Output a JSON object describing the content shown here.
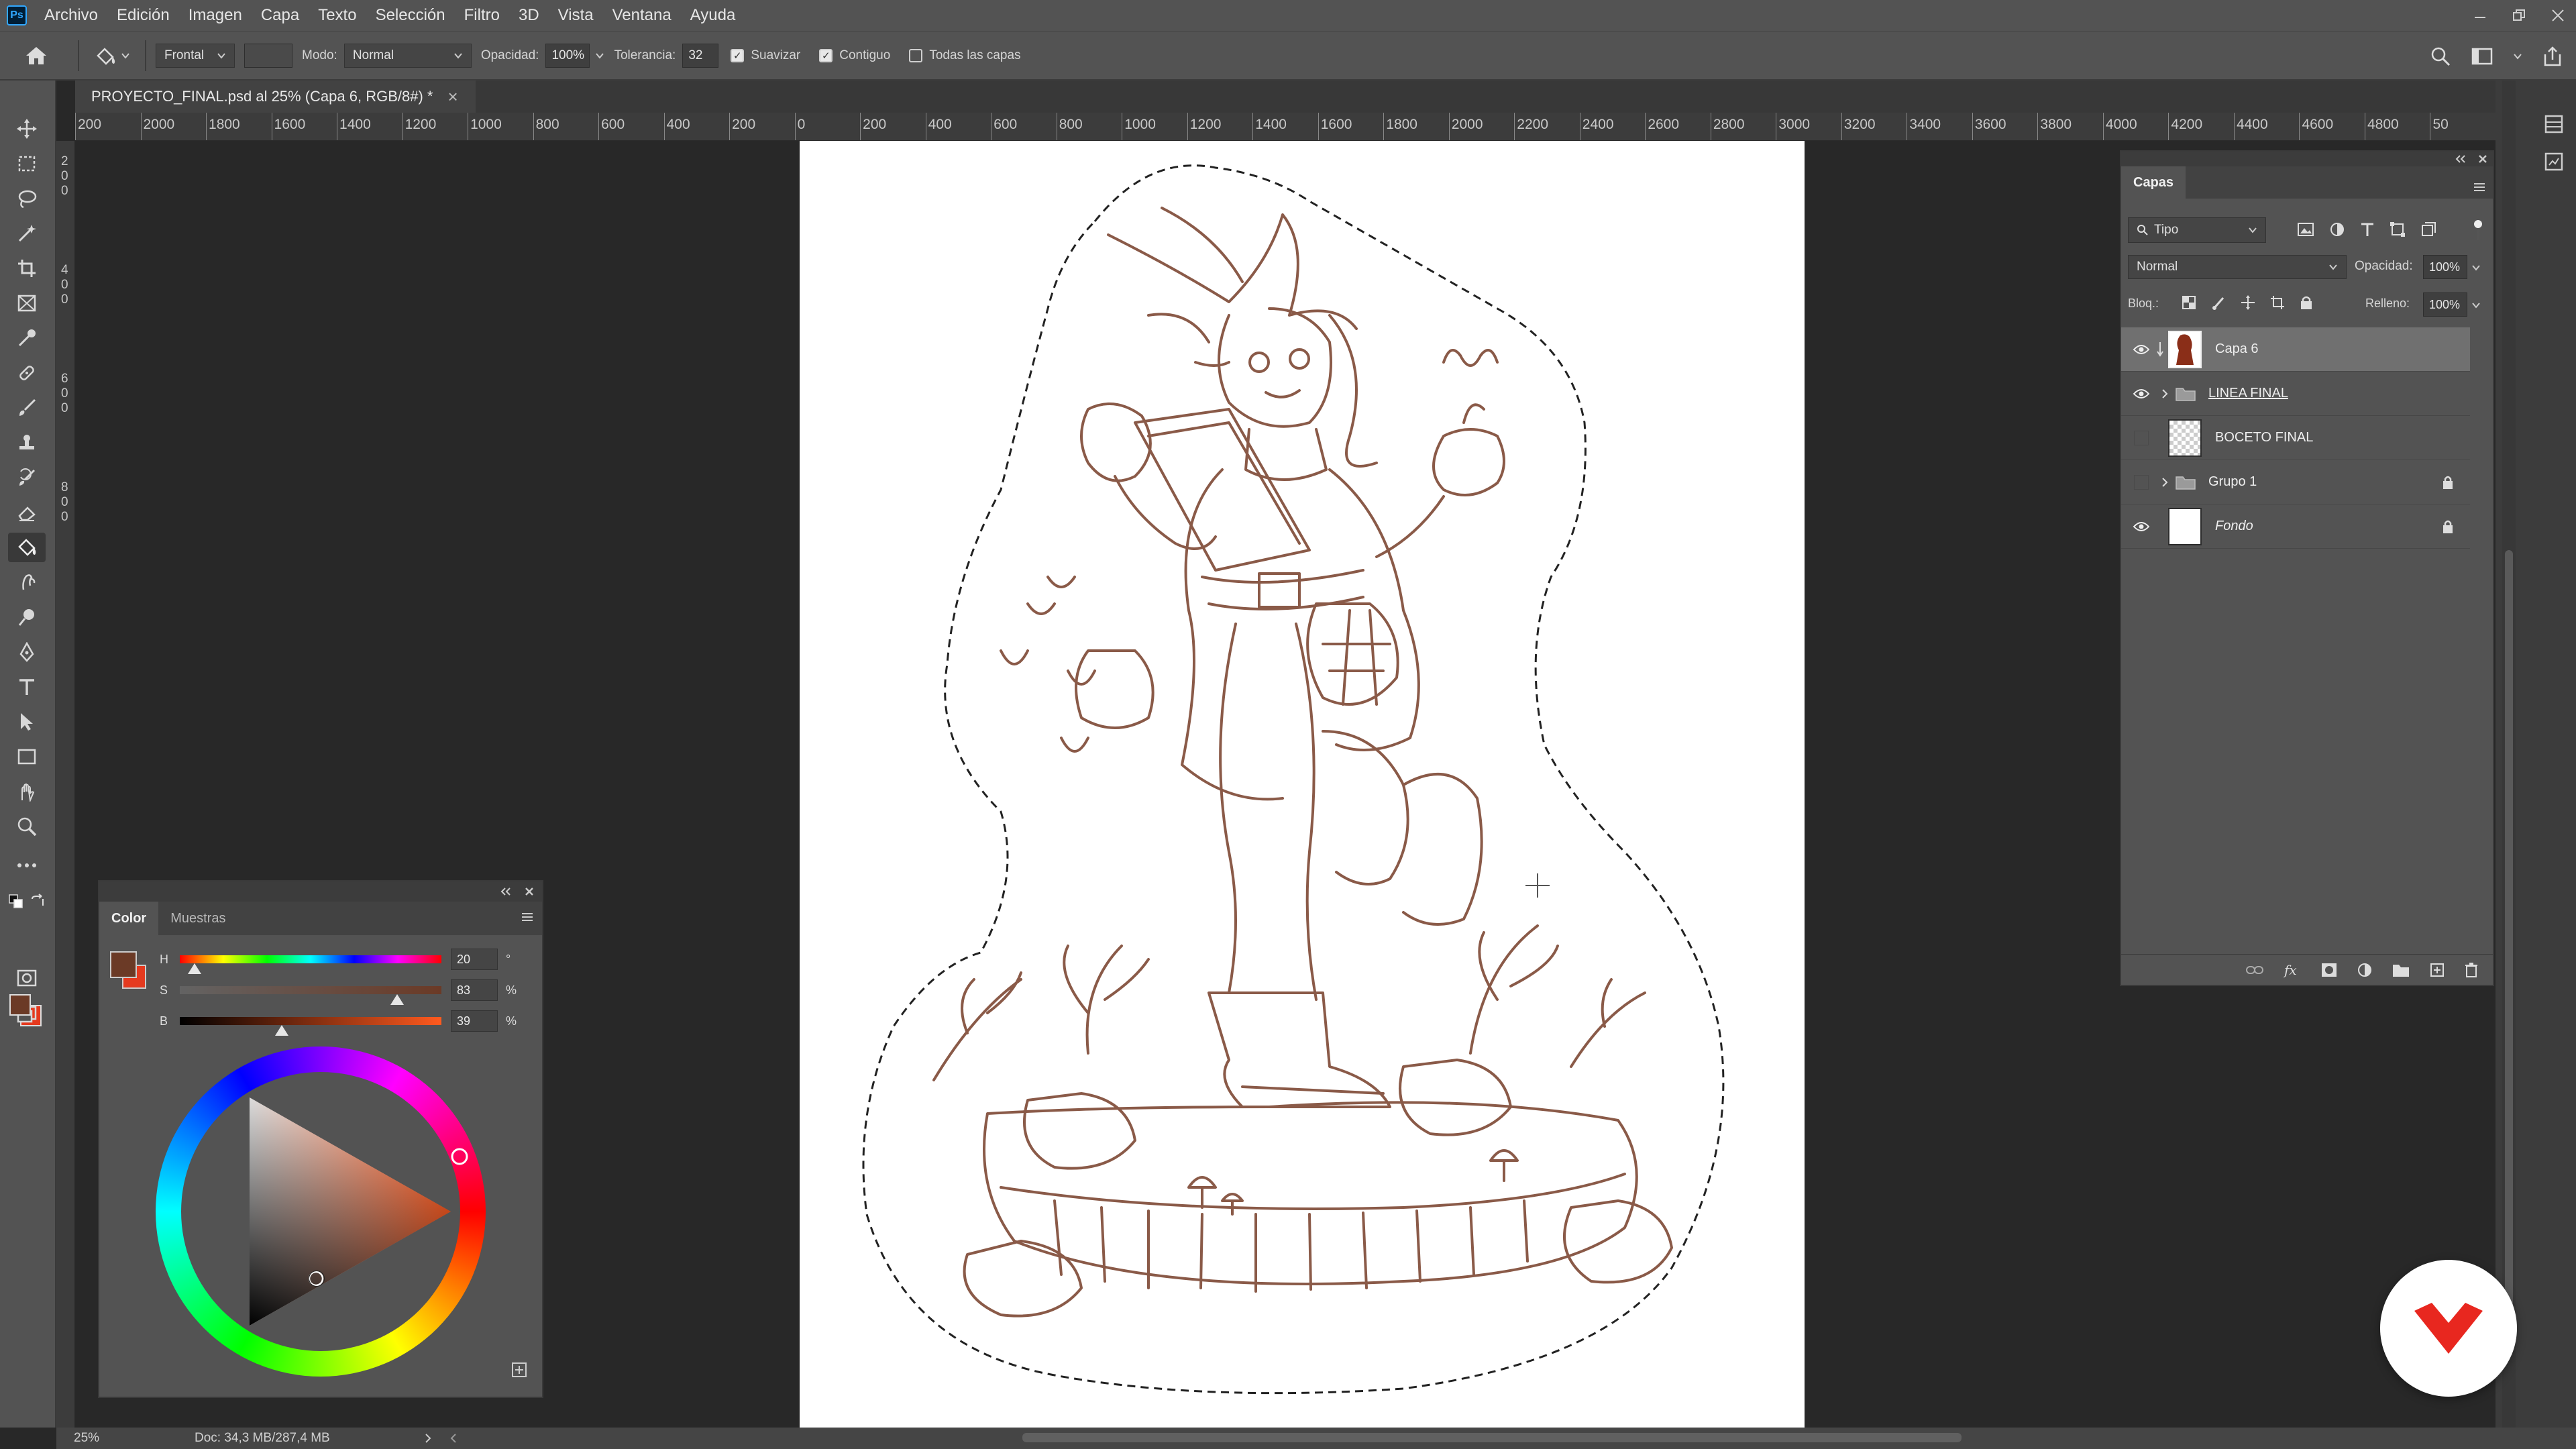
{
  "app": {
    "logo_text": "Ps",
    "menu": [
      "Archivo",
      "Edición",
      "Imagen",
      "Capa",
      "Texto",
      "Selección",
      "Filtro",
      "3D",
      "Vista",
      "Ventana",
      "Ayuda"
    ]
  },
  "options": {
    "sample_select": "Frontal",
    "mode_label": "Modo:",
    "mode_value": "Normal",
    "opacity_label": "Opacidad:",
    "opacity_value": "100%",
    "tolerance_label": "Tolerancia:",
    "tolerance_value": "32",
    "antialias_label": "Suavizar",
    "antialias_checked": true,
    "contiguous_label": "Contiguo",
    "contiguous_checked": true,
    "all_layers_label": "Todas las capas",
    "all_layers_checked": false
  },
  "document": {
    "tab_title": "PROYECTO_FINAL.psd al 25% (Capa 6, RGB/8#) *",
    "close_glyph": "×"
  },
  "ruler": {
    "top_labels": [
      "200",
      "2000",
      "1800",
      "1600",
      "1400",
      "1200",
      "1000",
      "800",
      "600",
      "400",
      "200",
      "0",
      "200",
      "400",
      "600",
      "800",
      "1000",
      "1200",
      "1400",
      "1600",
      "1800",
      "2000",
      "2200",
      "2400",
      "2600",
      "2800",
      "3000",
      "3200",
      "3400",
      "3600",
      "3800",
      "4000",
      "4200",
      "4400",
      "4600",
      "4800",
      "50"
    ],
    "left_labels": [
      "2",
      "0",
      "0",
      "4",
      "0",
      "0",
      "6",
      "0",
      "0",
      "8",
      "0",
      "0"
    ]
  },
  "status": {
    "zoom": "25%",
    "doc_info": "Doc: 34,3 MB/287,4 MB"
  },
  "color_panel": {
    "tabs": [
      "Color",
      "Muestras"
    ],
    "active_tab": "Color",
    "foreground_hex": "#6b3a26",
    "background_hex": "#e53a1f",
    "sliders": [
      {
        "letter": "H",
        "value": "20",
        "unit": "°",
        "fraction": 0.056
      },
      {
        "letter": "S",
        "value": "83",
        "unit": "%",
        "fraction": 0.83
      },
      {
        "letter": "B",
        "value": "39",
        "unit": "%",
        "fraction": 0.39
      }
    ]
  },
  "layers_panel": {
    "title": "Capas",
    "filter_label": "Tipo",
    "blend_mode": "Normal",
    "opacity_label": "Opacidad:",
    "opacity_value": "100%",
    "lock_label": "Bloq.:",
    "fill_label": "Relleno:",
    "fill_value": "100%",
    "layers": [
      {
        "name": "Capa 6",
        "visible": true,
        "selected": true,
        "type": "character",
        "locked": false
      },
      {
        "name": "LINEA FINAL",
        "visible": true,
        "selected": false,
        "type": "group",
        "locked": false
      },
      {
        "name": "BOCETO FINAL",
        "visible": false,
        "selected": false,
        "type": "transparent",
        "locked": false
      },
      {
        "name": "Grupo 1",
        "visible": false,
        "selected": false,
        "type": "group",
        "locked": true
      },
      {
        "name": "Fondo",
        "visible": true,
        "selected": false,
        "type": "white",
        "locked": true
      }
    ]
  },
  "colors": {
    "line_art": "#8a5a48",
    "accent_badge": "#e8271f"
  }
}
